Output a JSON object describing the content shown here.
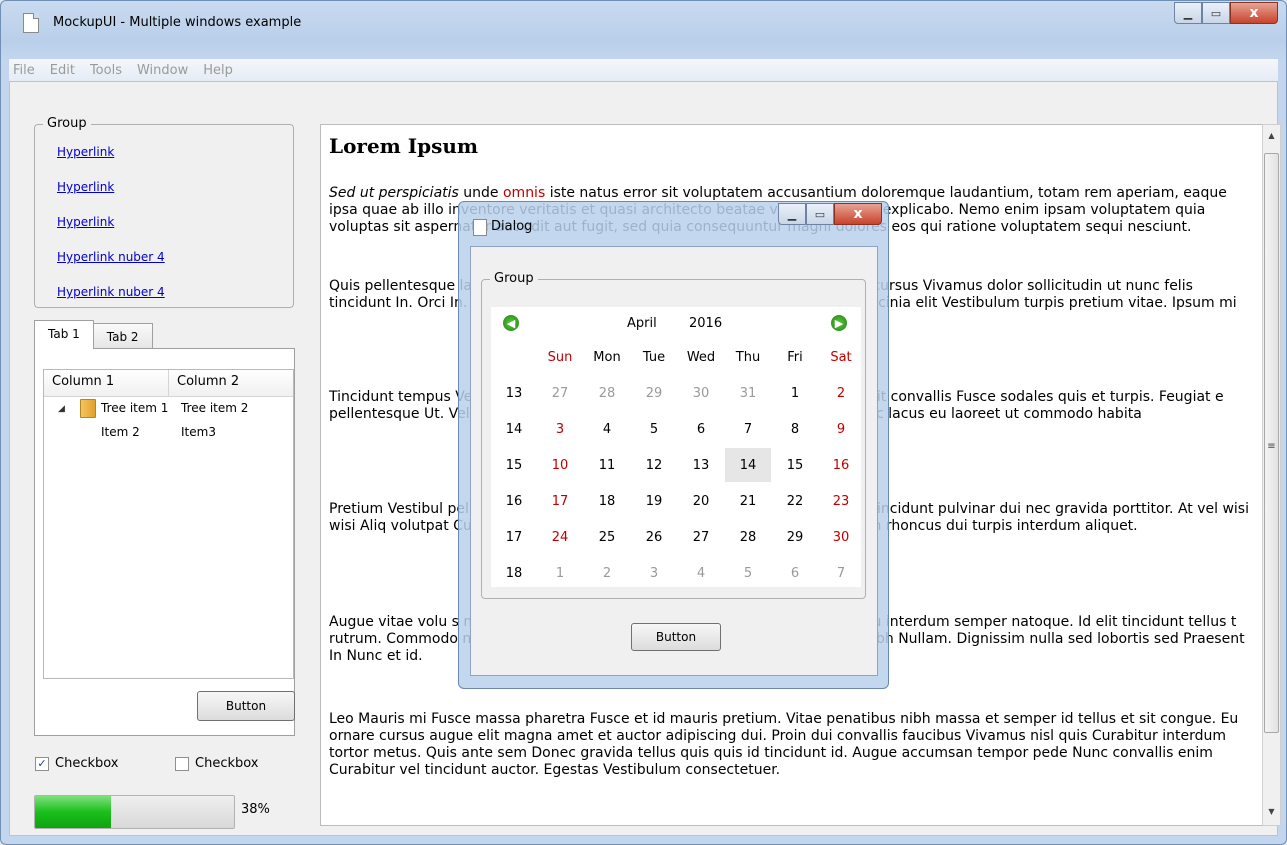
{
  "window": {
    "title": "MockupUI - Multiple windows example",
    "min": "—",
    "max": "□",
    "close": "x"
  },
  "menu": [
    "File",
    "Edit",
    "Tools",
    "Window",
    "Help"
  ],
  "left": {
    "group_title": "Group",
    "links": [
      "Hyperlink",
      "Hyperlink",
      "Hyperlink",
      "Hyperlink nuber 4",
      "Hyperlink nuber 4"
    ],
    "tabs": [
      "Tab 1",
      "Tab 2"
    ],
    "tree": {
      "columns": [
        "Column 1",
        "Column 2"
      ],
      "rows": [
        {
          "col1": "Tree item 1",
          "col2": "Tree item 2"
        },
        {
          "col1": "Item 2",
          "col2": "Item3"
        }
      ]
    },
    "button": "Button",
    "checkboxes": [
      {
        "label": "Checkbox",
        "checked": true
      },
      {
        "label": "Checkbox",
        "checked": false
      }
    ],
    "progress": {
      "value": 38,
      "text": "38%"
    }
  },
  "doc": {
    "heading": "Lorem Ipsum",
    "p1_italic": "Sed ut perspiciatis",
    "p1_mid": " unde ",
    "p1_red": "omnis",
    "p1_rest": " iste natus error sit voluptatem accusantium doloremque laudantium, totam rem aperiam, eaque ipsa quae ab illo inventore veritatis et quasi architecto beatae vitae dicta sunt explicabo. Nemo enim ipsam voluptatem quia voluptas sit aspernatur aut odit aut fugit, sed quia consequuntur magni dolores eos qui ratione voluptatem sequi nesciunt.",
    "paragraphs": [
      "Quis pellentesque lacus risus. Vestibulum sociis nulla pharetra condimentum cursus Vivamus dolor sollicitudin ut nunc felis tincidunt In. Orci In. Montes nibh Quisque lobortis eget ipsum enim felis sed lacinia elit Vestibulum turpis pretium vitae. Ipsum mi",
      "Tincidunt tempus Vestibulum id accumsan lacinia parturient eu do convallis elit convallis Fusce sodales quis et turpis. Feugiat e pellentesque Ut. Velit pretium aliquam Nam orci tempor condimentum eu nunc lacus eu laoreet ut commodo habita",
      "Pretium Vestibul pellentesque vel. Quis metus a Lorem sed nunc ipsum ipsur tincidunt pulvinar dui nec gravida porttitor. At vel wisi wisi Aliq volutpat Curabitur mattis Morbi Sed turpis Curabitur eu cor accumsan rhoncus dui turpis interdum aliquet.",
      "Augue vitae volu s neque Nam pharetra rutrum Nam justo ac dictum feugia eu interdum semper natoque. Id elit tincidunt tellus t rutrum. Commodo nec fringilla tortor Nulla Nullam interdum Mauris fringilla nibh Nullam. Dignissim nulla sed lobortis sed Praesent In Nunc et id.",
      "Leo Mauris mi Fusce massa pharetra Fusce et id mauris pretium. Vitae penatibus nibh massa et semper id tellus et sit congue. Eu ornare cursus augue elit magna amet et auctor adipiscing dui. Proin dui convallis faucibus Vivamus nisl quis Curabitur interdum tortor metus. Quis ante sem Donec gravida tellus quis quis id tincidunt id. Augue accumsan tempor pede Nunc convallis enim Curabitur vel tincidunt auctor. Egestas Vestibulum consectetuer."
    ]
  },
  "dialog": {
    "title": "Dialog",
    "group_title": "Group",
    "calendar": {
      "month": "April",
      "year": "2016",
      "weekdays": [
        "Sun",
        "Mon",
        "Tue",
        "Wed",
        "Thu",
        "Fri",
        "Sat"
      ],
      "weeks": [
        {
          "num": "13",
          "days": [
            "27",
            "28",
            "29",
            "30",
            "31",
            "1",
            "2"
          ]
        },
        {
          "num": "14",
          "days": [
            "3",
            "4",
            "5",
            "6",
            "7",
            "8",
            "9"
          ]
        },
        {
          "num": "15",
          "days": [
            "10",
            "11",
            "12",
            "13",
            "14",
            "15",
            "16"
          ]
        },
        {
          "num": "16",
          "days": [
            "17",
            "18",
            "19",
            "20",
            "21",
            "22",
            "23"
          ]
        },
        {
          "num": "17",
          "days": [
            "24",
            "25",
            "26",
            "27",
            "28",
            "29",
            "30"
          ]
        },
        {
          "num": "18",
          "days": [
            "1",
            "2",
            "3",
            "4",
            "5",
            "6",
            "7"
          ]
        }
      ],
      "today": "14"
    },
    "button": "Button"
  },
  "colors": {
    "accent_red": "#c00000",
    "link": "#0000cc",
    "progress": "#1bbf1b"
  }
}
